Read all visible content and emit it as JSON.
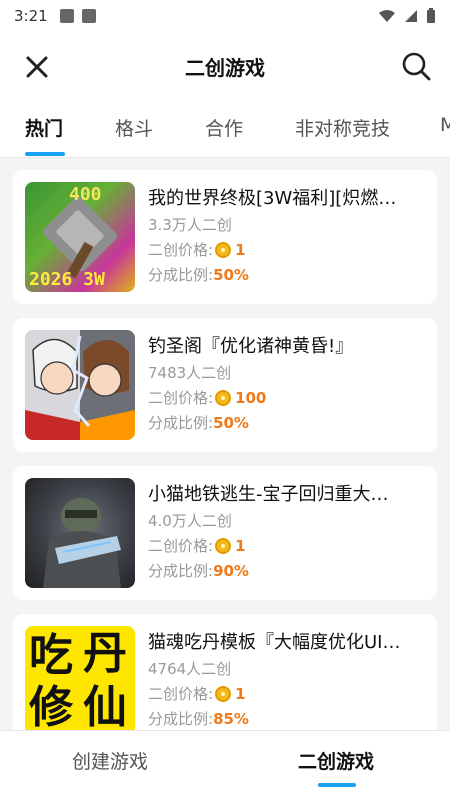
{
  "status": {
    "time": "3:21"
  },
  "header": {
    "title": "二创游戏"
  },
  "tabs": [
    {
      "label": "热门"
    },
    {
      "label": "格斗"
    },
    {
      "label": "合作"
    },
    {
      "label": "非对称竞技"
    },
    {
      "label": "M"
    }
  ],
  "games": [
    {
      "name": "我的世界终极[3W福利][炽燃…",
      "count": "3.3万人二创",
      "price_label": "二创价格:",
      "price": "1",
      "share_label": "分成比例:",
      "share": "50%",
      "thumb_text_top": "400",
      "thumb_text_bottom": "2026 3W"
    },
    {
      "name": "钓圣阁『优化诸神黄昏!』",
      "count": "7483人二创",
      "price_label": "二创价格:",
      "price": "100",
      "share_label": "分成比例:",
      "share": "50%"
    },
    {
      "name": "小猫地铁逃生-宝子回归重大…",
      "count": "4.0万人二创",
      "price_label": "二创价格:",
      "price": "1",
      "share_label": "分成比例:",
      "share": "90%"
    },
    {
      "name": "猫魂吃丹模板『大幅度优化UI…",
      "count": "4764人二创",
      "price_label": "二创价格:",
      "price": "1",
      "share_label": "分成比例:",
      "share": "85%",
      "thumb_text_1": "吃",
      "thumb_text_2": "丹",
      "thumb_text_3": "修",
      "thumb_text_4": "仙"
    }
  ],
  "bottom_nav": [
    {
      "label": "创建游戏"
    },
    {
      "label": "二创游戏"
    }
  ],
  "colors": {
    "accent": "#1aa1f0",
    "value": "#f07a1a",
    "coin": "#f5b818"
  }
}
